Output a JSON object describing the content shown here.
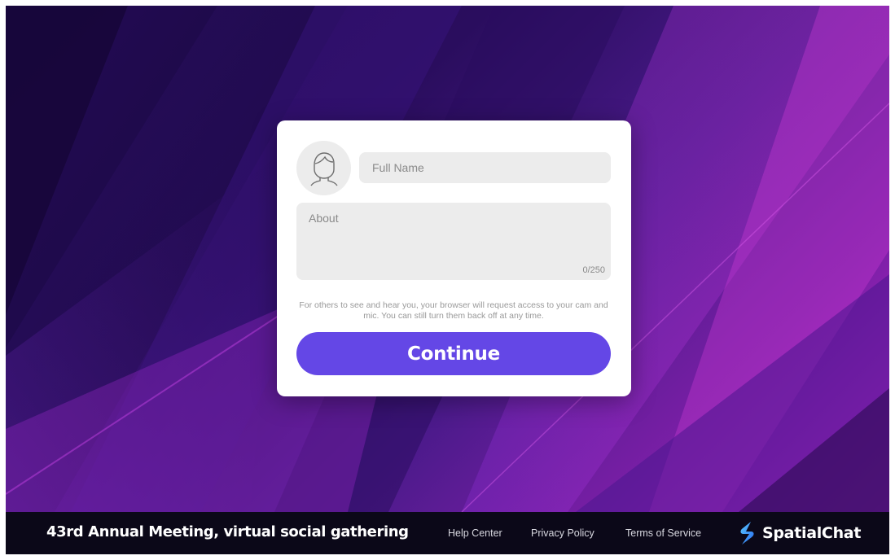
{
  "form": {
    "name_placeholder": "Full Name",
    "about_placeholder": "About",
    "about_counter": "0/250",
    "notice": "For others to see and hear you, your browser will request access to your cam and mic. You can still turn them back off at any time.",
    "continue_label": "Continue"
  },
  "footer": {
    "event_title": "43rd Annual Meeting, virtual social gathering",
    "links": [
      "Help Center",
      "Privacy Policy",
      "Terms of Service"
    ],
    "brand": "SpatialChat"
  },
  "colors": {
    "accent": "#6447e6",
    "footer_bg": "#0b0818",
    "card_bg": "#ffffff",
    "field_bg": "#ececec"
  },
  "icons": {
    "avatar": "user-avatar-icon",
    "logo": "spatialchat-logo-icon"
  }
}
